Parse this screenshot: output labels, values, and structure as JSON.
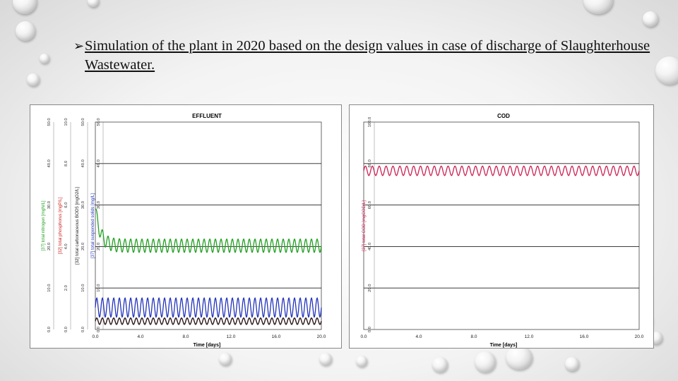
{
  "slide": {
    "bullet_glyph": "➢",
    "bullet_text": "Simulation of the plant in 2020 based on the design values in case of discharge of Slaughterhouse Wastewater."
  },
  "chart_data": [
    {
      "type": "line",
      "title": "EFFLUENT",
      "xlabel": "Time [days]",
      "x_ticks": [
        "0.0",
        "4.0",
        "8.0",
        "12.0",
        "16.0",
        "20.0"
      ],
      "xlim": [
        0,
        20
      ],
      "y_axes": [
        {
          "label": "[37] total nitrogen [mgN/L]",
          "color": "#22a022",
          "ticks": [
            "0.0",
            "10.0",
            "20.0",
            "30.0",
            "40.0",
            "50.0"
          ],
          "ylim": [
            0,
            50
          ]
        },
        {
          "label": "[32] total phosphorus [mgP/L]",
          "color": "#cc2222",
          "ticks": [
            "0.0",
            "2.0",
            "4.0",
            "6.0",
            "8.0",
            "10.0"
          ],
          "ylim": [
            0,
            10
          ]
        },
        {
          "label": "[32] total carbonaceous BOD5 [mgO2/L]",
          "color": "#222222",
          "ticks": [
            "0.0",
            "10.0",
            "20.0",
            "30.0",
            "40.0",
            "50.0"
          ],
          "ylim": [
            0,
            50
          ]
        },
        {
          "label": "[37] total suspended solids [mg/L]",
          "color": "#2233bb",
          "ticks": [
            "0.0",
            "10.0",
            "20.0",
            "30.0",
            "40.0",
            "50.0"
          ],
          "ylim": [
            0,
            50
          ]
        }
      ],
      "series": [
        {
          "name": "[37] total nitrogen",
          "color": "#22a022",
          "axis": 0,
          "start": 29,
          "base": 20.2,
          "decay": 0.45,
          "amp": 1.6,
          "cycles": 40
        },
        {
          "name": "[37] total suspended solids",
          "color": "#2233bb",
          "axis": 3,
          "start": 5.3,
          "base": 5.3,
          "decay": 1,
          "amp": 2.3,
          "cycles": 40
        },
        {
          "name": "[32] total phosphorus",
          "color": "#cc2222",
          "axis": 1,
          "start": 0.4,
          "base": 0.4,
          "decay": 1,
          "amp": 0.15,
          "cycles": 40
        },
        {
          "name": "[32] total carbonaceous BOD5",
          "color": "#222222",
          "axis": 2,
          "start": 2.0,
          "base": 2.0,
          "decay": 1,
          "amp": 0.8,
          "cycles": 40
        }
      ]
    },
    {
      "type": "line",
      "title": "COD",
      "xlabel": "Time [days]",
      "x_ticks": [
        "0.0",
        "4.0",
        "8.0",
        "12.0",
        "16.0",
        "20.0"
      ],
      "xlim": [
        0,
        20
      ],
      "y_axes": [
        {
          "label": "[37] total COD [mgCOD/L]",
          "color": "#cc2255",
          "ticks": [
            "0.0",
            "20.0",
            "40.0",
            "60.0",
            "80.0",
            "100.0"
          ],
          "ylim": [
            0,
            100
          ]
        }
      ],
      "series": [
        {
          "name": "[37] total COD",
          "color": "#cc2255",
          "axis": 0,
          "start": 76.5,
          "base": 76.5,
          "decay": 1,
          "amp": 2.3,
          "cycles": 40
        }
      ]
    }
  ]
}
